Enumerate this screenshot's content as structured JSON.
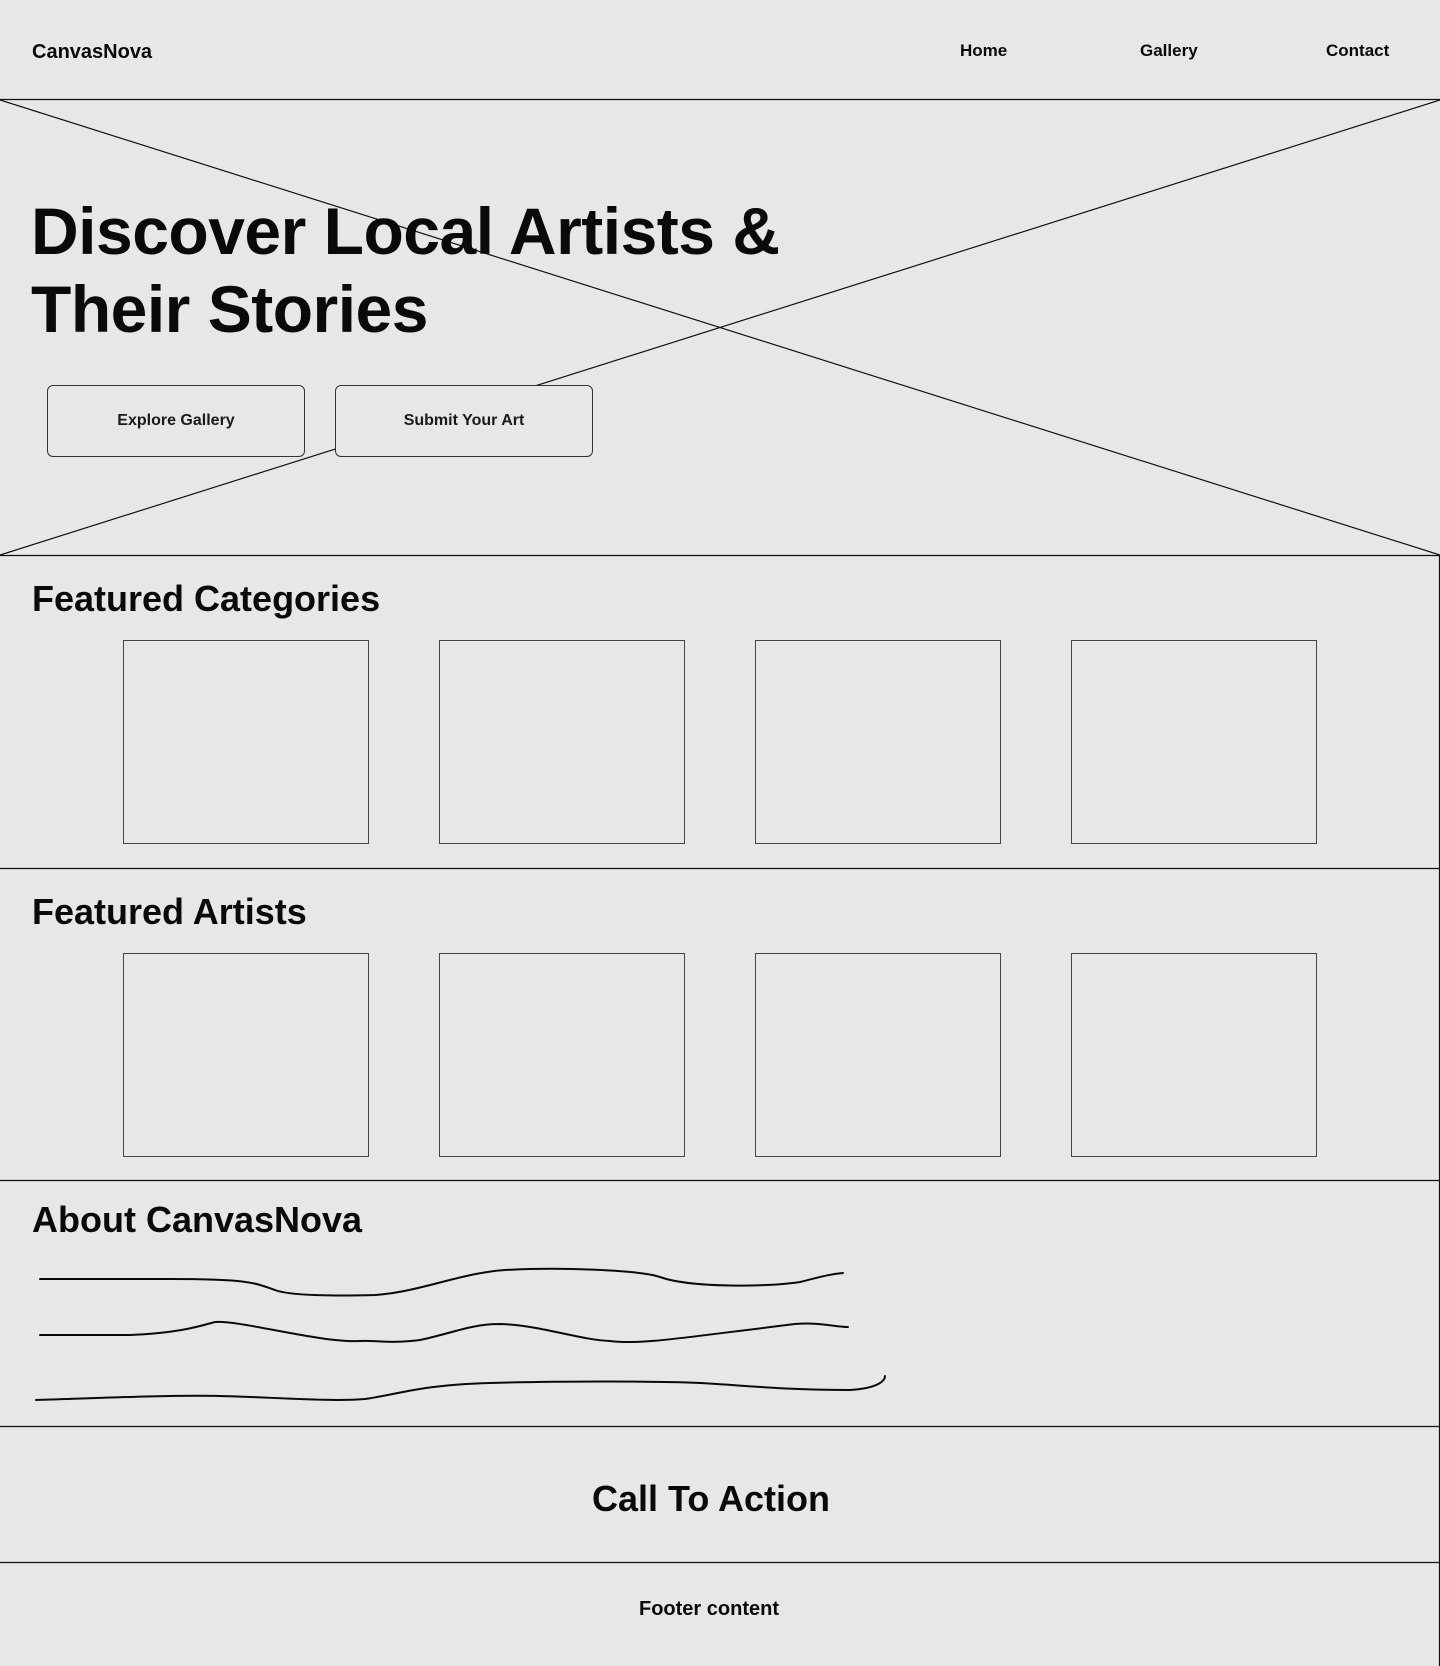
{
  "header": {
    "brand": "CanvasNova",
    "nav": [
      "Home",
      "Gallery",
      "Contact"
    ]
  },
  "hero": {
    "title_line1": "Discover Local Artists &",
    "title_line2": "Their Stories",
    "primary_button": "Explore Gallery",
    "secondary_button": "Submit Your Art"
  },
  "categories": {
    "title": "Featured Categories",
    "card_count": 4
  },
  "artists": {
    "title": "Featured Artists",
    "card_count": 4
  },
  "about": {
    "title": "About CanvasNova",
    "placeholder_lines": 3
  },
  "cta": {
    "title": "Call To Action"
  },
  "footer": {
    "text": "Footer content"
  },
  "colors": {
    "background": "#e7e7e7",
    "line": "#111111"
  }
}
